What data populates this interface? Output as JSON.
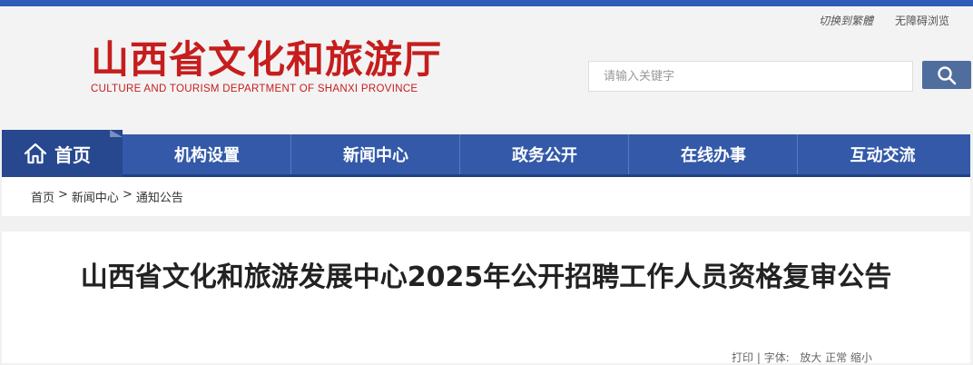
{
  "header": {
    "util_links": {
      "traditional": "切换到繁體",
      "accessible": "无障碍浏览"
    },
    "logo": {
      "name_cn": "山西省文化和旅游厅",
      "name_en": "CULTURE AND TOURISM DEPARTMENT OF SHANXI PROVINCE"
    },
    "search": {
      "placeholder": "请输入关键字"
    }
  },
  "nav": {
    "home_label": "首页",
    "items": [
      {
        "label": "机构设置"
      },
      {
        "label": "新闻中心"
      },
      {
        "label": "政务公开"
      },
      {
        "label": "在线办事"
      },
      {
        "label": "互动交流"
      }
    ]
  },
  "breadcrumb": [
    {
      "label": "首页"
    },
    {
      "label": "新闻中心"
    },
    {
      "label": "通知公告"
    }
  ],
  "breadcrumb_sep": ">",
  "article": {
    "title": "山西省文化和旅游发展中心2025年公开招聘工作人员资格复审公告",
    "tools": {
      "print": "打印",
      "sep": "|",
      "font_label": "字体:",
      "large": "放大",
      "normal": "正常",
      "small": "缩小"
    }
  },
  "colors": {
    "topbar": "#2f5cb4",
    "nav": "#3359a8",
    "nav_home": "#27488f",
    "logo": "#c61d1d",
    "search_btn": "#4f6e9d"
  }
}
